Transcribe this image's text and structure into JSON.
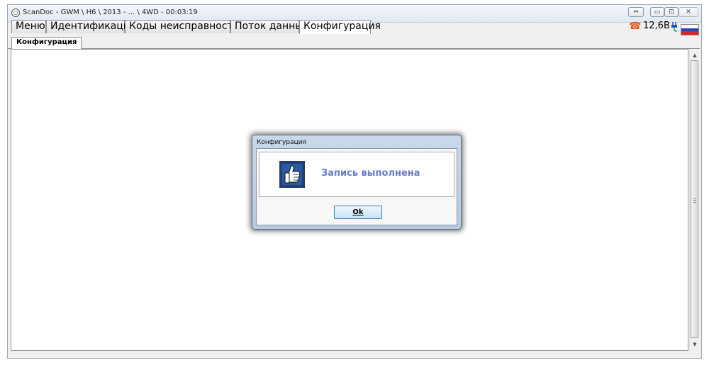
{
  "window": {
    "title": "ScanDoc - GWM \\ H6 \\ 2013 - ... \\ 4WD - 00:03:19",
    "controls": {
      "minimize": "▭",
      "maximize": "⊡",
      "close": "✕",
      "extra": "⇔"
    }
  },
  "tabs": [
    {
      "label": "Меню"
    },
    {
      "label": "Идентификация"
    },
    {
      "label": "Коды неисправностей"
    },
    {
      "label": "Поток данных"
    },
    {
      "label": "Конфигурация"
    }
  ],
  "status": {
    "voltage": "12,6В",
    "phone_icon": "phone-icon",
    "plug_icon": "plug-icon",
    "flag": "russian-flag",
    "flag_colors": [
      "#ffffff",
      "#1c4bb4",
      "#e0202a"
    ]
  },
  "subtab": {
    "label": "Конфигурация"
  },
  "dialog": {
    "title": "Конфигурация",
    "message": "Запись выполнена",
    "ok_label": "Ok",
    "icon": "thumbs-up-icon",
    "message_color": "#6a7bc8"
  }
}
